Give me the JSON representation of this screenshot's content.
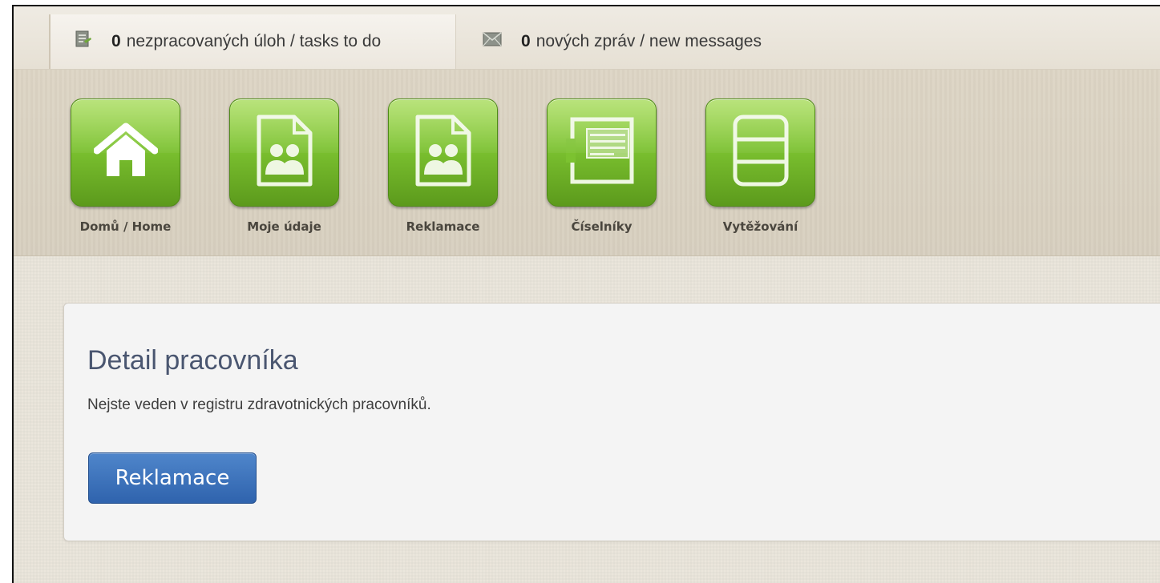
{
  "topbar": {
    "tasks": {
      "count": "0",
      "text": "nezpracovaných úloh / tasks to do",
      "icon": "tasks-document-icon"
    },
    "messages": {
      "count": "0",
      "text": "nových zpráv / new messages",
      "icon": "envelope-icon"
    }
  },
  "menu": {
    "items": [
      {
        "label": "Domů / Home",
        "icon": "home-icon"
      },
      {
        "label": "Moje údaje",
        "icon": "user-document-icon"
      },
      {
        "label": "Reklamace",
        "icon": "user-document-icon"
      },
      {
        "label": "Číselníky",
        "icon": "codelist-icon"
      },
      {
        "label": "Vytěžování",
        "icon": "stack-icon"
      }
    ],
    "tile_color": "#7cc230"
  },
  "detail": {
    "title": "Detail pracovníka",
    "message": "Nejste veden v registru zdravotnických pracovníků.",
    "button_label": "Reklamace",
    "button_color": "#3a6fb8"
  }
}
